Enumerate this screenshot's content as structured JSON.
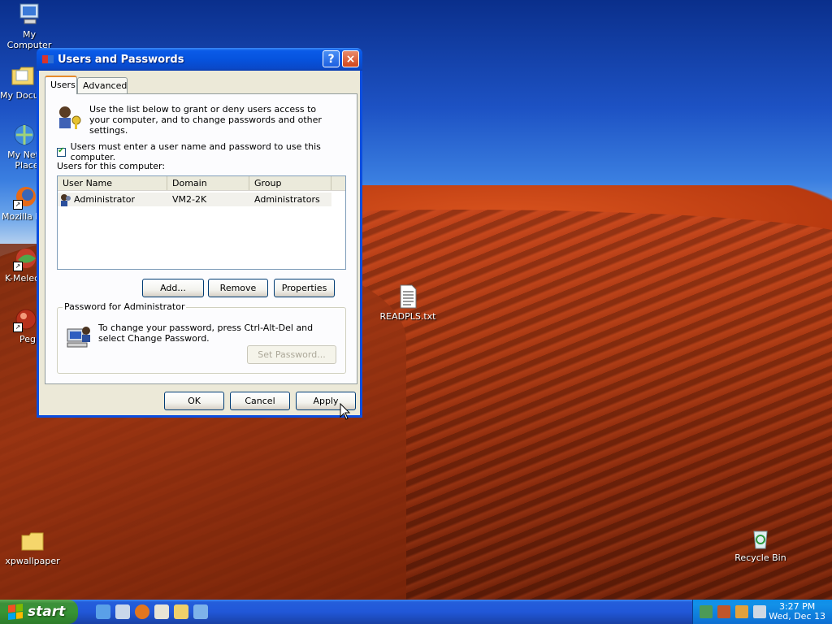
{
  "desktop": {
    "icons": [
      {
        "label": "My Computer"
      },
      {
        "label": "My Docu"
      },
      {
        "label": "My Netw Place"
      },
      {
        "label": "Mozilla Fi"
      },
      {
        "label": "K-Melec"
      },
      {
        "label": "Peg"
      },
      {
        "label": "READPLS.txt"
      },
      {
        "label": "xpwallpaper"
      },
      {
        "label": "Recycle Bin"
      }
    ]
  },
  "dialog": {
    "title": "Users and Passwords",
    "help_glyph": "?",
    "close_glyph": "×",
    "tabs": [
      {
        "label": "Users"
      },
      {
        "label": "Advanced"
      }
    ],
    "info_text": "Use the list below to grant or deny users access to your computer, and to change passwords and other settings.",
    "checkbox_label": "Users must enter a user name and password to use this computer.",
    "users_label": "Users for this computer:",
    "list": {
      "columns": [
        "User Name",
        "Domain",
        "Group"
      ],
      "rows": [
        {
          "user": "Administrator",
          "domain": "VM2-2K",
          "group": "Administrators"
        }
      ]
    },
    "buttons": {
      "add": "Add...",
      "remove": "Remove",
      "properties": "Properties",
      "set_password": "Set Password...",
      "ok": "OK",
      "cancel": "Cancel",
      "apply": "Apply"
    },
    "password_group": {
      "title": "Password for Administrator",
      "text": "To change your password, press Ctrl-Alt-Del and select Change Password."
    }
  },
  "taskbar": {
    "start_label": "start",
    "clock_time": "3:27 PM",
    "clock_date": "Wed, Dec 13"
  }
}
